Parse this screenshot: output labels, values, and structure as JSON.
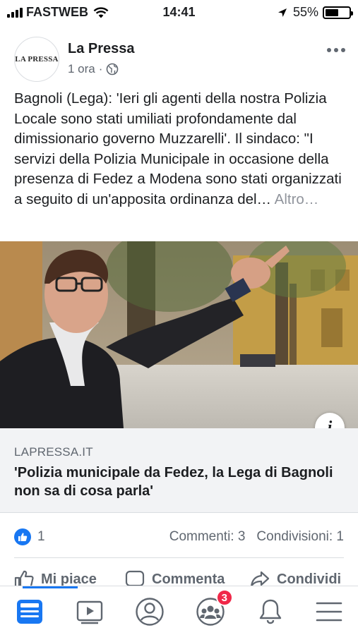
{
  "status_bar": {
    "carrier": "FASTWEB",
    "time": "14:41",
    "battery": "55%",
    "battery_level": 0.55
  },
  "post": {
    "page_name": "La Pressa",
    "avatar_logo_text": "LA PRESSA",
    "time_ago": "1 ora",
    "dot": "·",
    "audience_icon": "globe-icon",
    "text": "Bagnoli (Lega): 'Ieri gli agenti della nostra Polizia Locale sono stati umiliati profondamente dal dimissionario governo Muzzarelli'. Il sindaco: \"I servizi della Polizia Municipale in occasione della presenza di Fedez a Modena sono stati organizzati a seguito di un'apposita ordinanza del…",
    "see_more": "Altro…"
  },
  "link": {
    "domain": "LAPRESSA.IT",
    "title": "'Polizia municipale da Fedez, la Lega di Bagnoli non sa di cosa parla'",
    "info_label": "i"
  },
  "reactions": {
    "count": "1",
    "comments": "Commenti: 3",
    "shares": "Condivisioni: 1"
  },
  "actions": {
    "like": "Mi piace",
    "comment": "Commenta",
    "share": "Condividi"
  },
  "tabbar": {
    "groups_badge": "3"
  },
  "colors": {
    "accent": "#1877f2",
    "badge": "#f02849",
    "secondary_text": "#606770"
  }
}
